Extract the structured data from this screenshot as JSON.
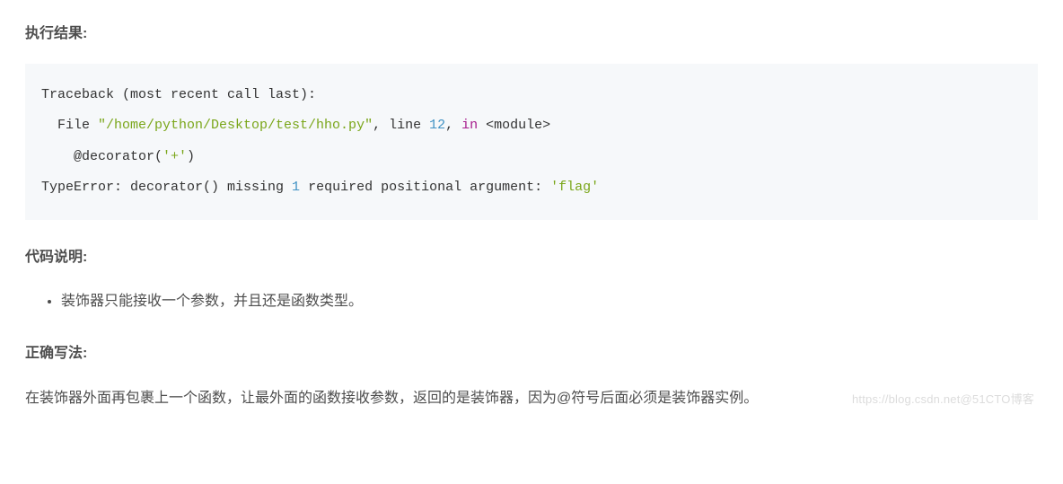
{
  "headings": {
    "result": "执行结果:",
    "explain": "代码说明:",
    "correct": "正确写法:"
  },
  "code": {
    "line1_pre": "Traceback (most recent call last):",
    "line2_pre": "  File ",
    "line2_path": "\"/home/python/Desktop/test/hho.py\"",
    "line2_mid": ", line ",
    "line2_lineno": "12",
    "line2_post": ", ",
    "line2_in": "in",
    "line2_tail": " <module>",
    "line3": "    @decorator(",
    "line3_arg": "'+'",
    "line3_close": ")",
    "line4_pre": "TypeError: decorator() missing ",
    "line4_num": "1",
    "line4_mid": " required positional argument: ",
    "line4_flag": "'flag'"
  },
  "explain": {
    "item1": "装饰器只能接收一个参数，并且还是函数类型。"
  },
  "correct_paragraph": "在装饰器外面再包裹上一个函数，让最外面的函数接收参数，返回的是装饰器，因为@符号后面必须是装饰器实例。",
  "watermark": "https://blog.csdn.net@51CTO博客"
}
